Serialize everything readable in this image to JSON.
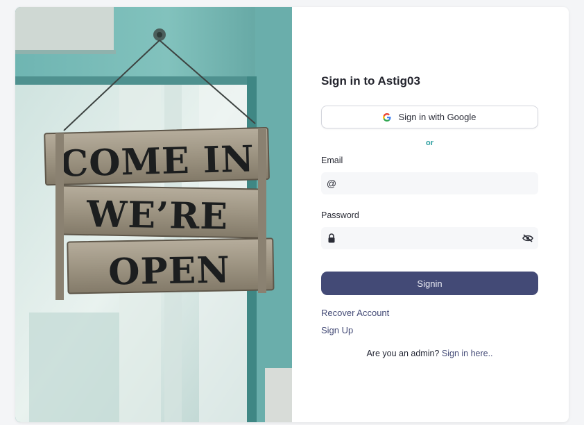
{
  "hero": {
    "sign_lines": [
      "COME IN",
      "WE’RE",
      "OPEN"
    ]
  },
  "form": {
    "title": "Sign in to Astig03",
    "google_button": "Sign in with Google",
    "divider": "or",
    "email": {
      "label": "Email",
      "value": "",
      "placeholder": ""
    },
    "password": {
      "label": "Password",
      "value": "",
      "placeholder": ""
    },
    "submit_label": "Signin",
    "recover_link": "Recover Account",
    "signup_link": "Sign Up",
    "admin_prompt": "Are you an admin?",
    "admin_link": "Sign in here.."
  },
  "colors": {
    "primary": "#434a76",
    "accent": "#2a9d9f",
    "field_bg": "#f6f7f9"
  },
  "icons": {
    "email": "at-icon",
    "password": "lock-icon",
    "toggle": "eye-slash-icon",
    "google": "google-icon"
  }
}
